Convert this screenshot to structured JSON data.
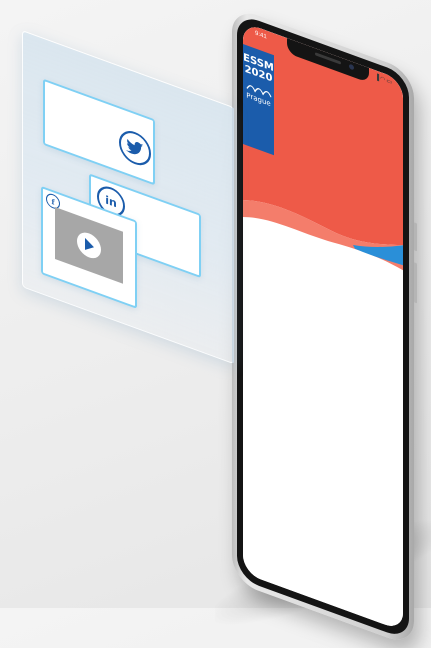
{
  "phone": {
    "status_time": "9:41",
    "status_icons": "▐◠▭",
    "screen_colors": {
      "top": "#ee5a48",
      "wave": "#f47d6b",
      "accent": "#2a8fd8",
      "bottom": "#ffffff"
    }
  },
  "logo": {
    "line1": "ESSM",
    "line2": "2020",
    "city": "Prague",
    "color": "#1b5cab"
  },
  "social": {
    "twitter": {
      "icon": "twitter-icon",
      "color": "#1b5cab"
    },
    "linkedin": {
      "icon": "linkedin-icon",
      "label": "in"
    },
    "facebook": {
      "icon": "facebook-icon",
      "label": "f"
    },
    "video": {
      "icon": "play-icon"
    },
    "bubble_border_color": "#7fd0f4"
  }
}
